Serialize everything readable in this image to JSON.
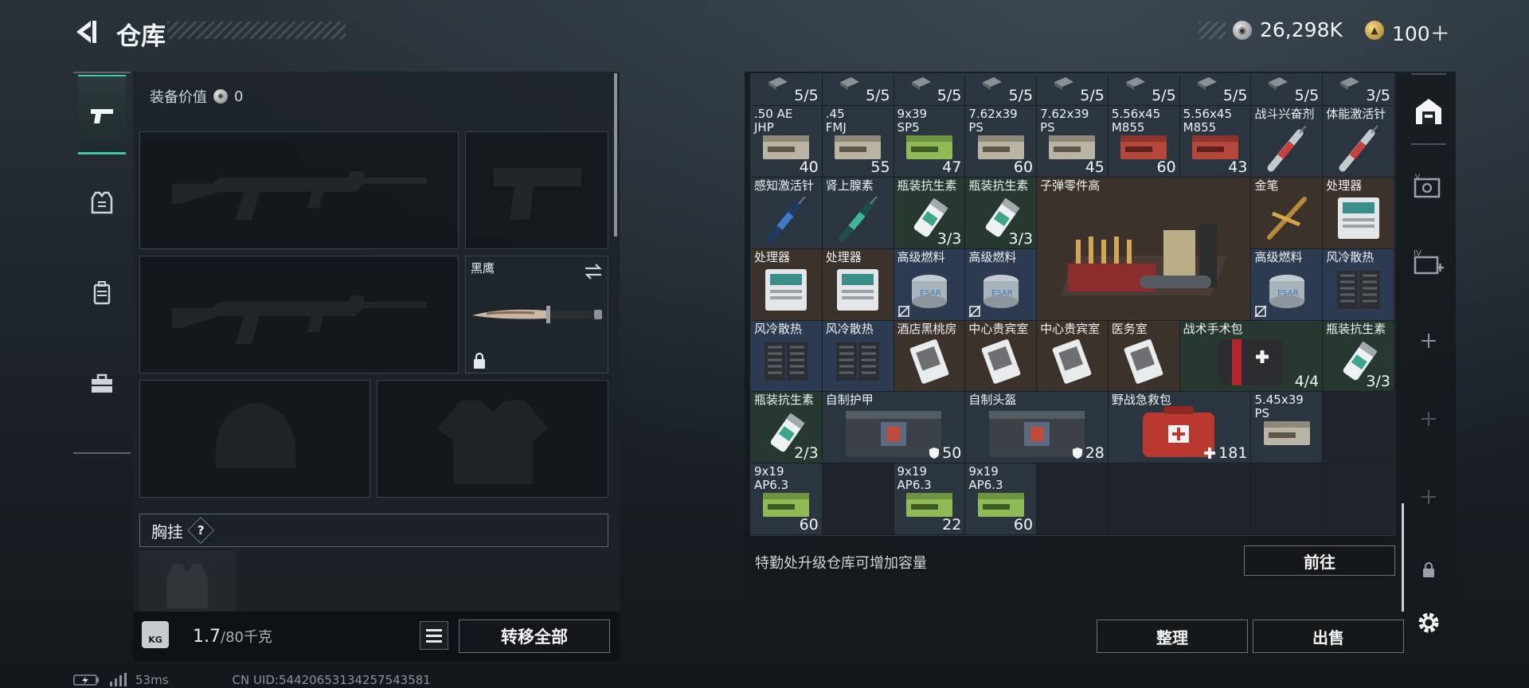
{
  "header": {
    "title": "仓库"
  },
  "currency": {
    "silver_icon": "silver-coin-icon",
    "silver": "26,298K",
    "gold_icon": "gold-coin-icon",
    "gold": "100＋"
  },
  "left_tabs": [
    {
      "icon": "pistol-icon",
      "active": true
    },
    {
      "icon": "armor-icon",
      "active": false
    },
    {
      "icon": "backpack-icon",
      "active": false
    },
    {
      "icon": "toolbox-icon",
      "active": false
    }
  ],
  "equipment": {
    "value_label": "装备价值",
    "value": "0",
    "knife_label": "黑鹰",
    "chest_label": "胸挂",
    "help": "?"
  },
  "weight": {
    "icon_text": "KG",
    "current": "1.7",
    "max": "/80千克"
  },
  "transfer_all": "转移全部",
  "warehouse": {
    "ammo_top_row": [
      "5/5",
      "5/5",
      "5/5",
      "5/5",
      "5/5",
      "5/5",
      "5/5",
      "5/5",
      "3/5"
    ],
    "items": [
      {
        "name": ".50 AE\nJHP",
        "qty": "40",
        "kind": "ammo-tan"
      },
      {
        "name": ".45\nFMJ",
        "qty": "55",
        "kind": "ammo-tan"
      },
      {
        "name": "9x39\nSP5",
        "qty": "47",
        "kind": "ammo-green"
      },
      {
        "name": "7.62x39\nPS",
        "qty": "60",
        "kind": "ammo-tan"
      },
      {
        "name": "7.62x39\nPS",
        "qty": "45",
        "kind": "ammo-tan"
      },
      {
        "name": "5.56x45\nM855",
        "qty": "60",
        "kind": "ammo-red"
      },
      {
        "name": "5.56x45\nM855",
        "qty": "43",
        "kind": "ammo-red"
      },
      {
        "name": "战斗兴奋剂",
        "qty": "",
        "kind": "syringe-red"
      },
      {
        "name": "体能激活针",
        "qty": "",
        "kind": "syringe-red"
      },
      {
        "name": "感知激活针",
        "qty": "",
        "kind": "syringe-blue"
      },
      {
        "name": "肾上腺素",
        "qty": "",
        "kind": "syringe-teal"
      },
      {
        "name": "瓶装抗生素",
        "qty": "3/3",
        "kind": "pills"
      },
      {
        "name": "瓶装抗生素",
        "qty": "3/3",
        "kind": "pills"
      },
      {
        "name": "子弹零件高",
        "qty": "",
        "kind": "parts-box"
      },
      {
        "name": "金笔",
        "qty": "",
        "kind": "gold-pen"
      },
      {
        "name": "处理器",
        "qty": "",
        "kind": "processor"
      },
      {
        "name": "处理器",
        "qty": "",
        "kind": "processor"
      },
      {
        "name": "处理器",
        "qty": "",
        "kind": "processor"
      },
      {
        "name": "高级燃料",
        "qty": "",
        "kind": "fuel"
      },
      {
        "name": "高级燃料",
        "qty": "",
        "kind": "fuel"
      },
      {
        "name": "高级燃料",
        "qty": "",
        "kind": "fuel"
      },
      {
        "name": "风冷散热",
        "qty": "",
        "kind": "cooler"
      },
      {
        "name": "风冷散热",
        "qty": "",
        "kind": "cooler"
      },
      {
        "name": "风冷散热",
        "qty": "",
        "kind": "cooler"
      },
      {
        "name": "酒店黑桃房",
        "qty": "",
        "kind": "keycard"
      },
      {
        "name": "中心贵宾室",
        "qty": "",
        "kind": "keycard"
      },
      {
        "name": "中心贵宾室",
        "qty": "",
        "kind": "keycard"
      },
      {
        "name": "医务室",
        "qty": "",
        "kind": "keycard"
      },
      {
        "name": "战术手术包",
        "qty": "4/4",
        "kind": "surgical-kit"
      },
      {
        "name": "瓶装抗生素",
        "qty": "3/3",
        "kind": "pills"
      },
      {
        "name": "瓶装抗生素",
        "qty": "2/3",
        "kind": "pills"
      },
      {
        "name": "自制护甲",
        "qty": "50",
        "kind": "armor-case"
      },
      {
        "name": "自制头盔",
        "qty": "28",
        "kind": "armor-case"
      },
      {
        "name": "野战急救包",
        "qty": "181",
        "kind": "medkit"
      },
      {
        "name": "5.45x39\nPS",
        "qty": "",
        "kind": "ammo-tan"
      },
      {
        "name": "9x19\nAP6.3",
        "qty": "60",
        "kind": "ammo-green"
      },
      {
        "name": "9x19\nAP6.3",
        "qty": "22",
        "kind": "ammo-green"
      },
      {
        "name": "9x19\nAP6.3",
        "qty": "60",
        "kind": "ammo-green"
      }
    ],
    "upgrade_hint": "特勤处升级仓库可增加容量",
    "goto": "前往",
    "sort": "整理",
    "sell": "出售"
  },
  "right_sidebar": [
    {
      "icon": "warehouse-icon"
    },
    {
      "icon": "vault-icon"
    },
    {
      "icon": "expansion-iv-icon"
    },
    {
      "icon": "add-icon"
    },
    {
      "icon": "add-icon"
    },
    {
      "icon": "add-icon"
    },
    {
      "icon": "lock-icon"
    },
    {
      "icon": "settings-icon"
    }
  ],
  "status": {
    "ping": "53ms",
    "uid": "CN UID:54420653134257543581"
  },
  "colors": {
    "accent": "#3fc8a8",
    "cell_dark": "#2a3540",
    "cell_brown": "#3b332b",
    "cell_blue": "#2c3a52"
  }
}
